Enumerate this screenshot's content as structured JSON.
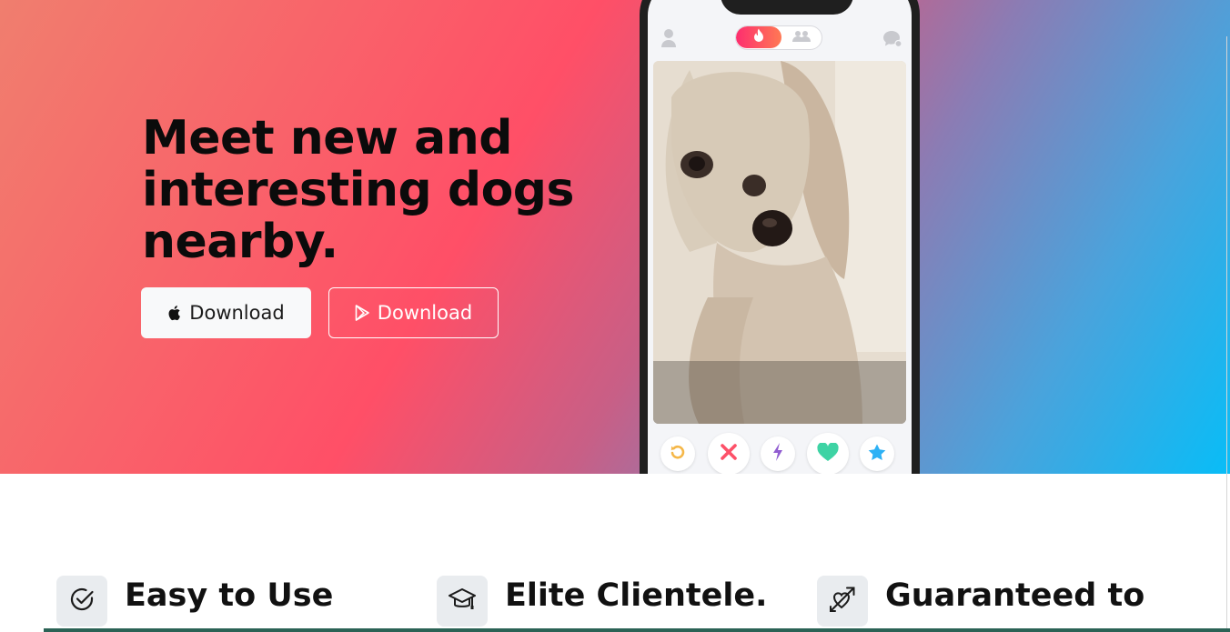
{
  "hero": {
    "headline": "Meet new and interesting dogs nearby.",
    "apple_button_label": "Download",
    "play_button_label": "Download"
  },
  "phone": {
    "top_icons": [
      "profile-icon",
      "flame-icon",
      "group-icon",
      "chat-icon"
    ],
    "action_icons": [
      "rewind-icon",
      "nope-icon",
      "boost-icon",
      "like-icon",
      "super-like-icon"
    ],
    "colors": {
      "rewind": "#f5b748",
      "nope": "#fd5068",
      "boost": "#915dd1",
      "like": "#3ed3a4",
      "super_like": "#2db1f5"
    }
  },
  "features": [
    {
      "title": "Easy to Use",
      "icon": "check-circle-icon"
    },
    {
      "title": "Elite Clientele.",
      "icon": "graduation-cap-icon"
    },
    {
      "title": "Guaranteed to",
      "icon": "heart-arrow-icon"
    }
  ]
}
